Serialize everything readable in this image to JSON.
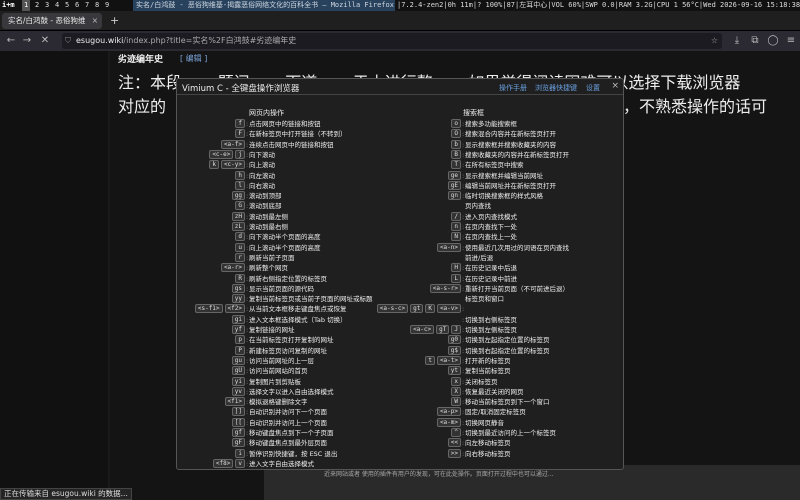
{
  "topbar": {
    "logo": "i+m",
    "workspaces": [
      "1",
      "2",
      "3",
      "4",
      "5",
      "6",
      "7",
      "8",
      "9"
    ],
    "active_workspace": "1",
    "window_title": "实名/白鸿鼓 - 恶俗狗维基-揭露恶俗网络文化的百科全书 — Mozilla Firefox",
    "status": "|7.2.4-zen2|0h 11m|? 100%|87|左耳中心|VOL 60%|SWP 0.0|RAM 3.2G|CPU 1 56°C|Wed 2026-09-16 15:18:38"
  },
  "tab": {
    "title": "实名/白鸿鼓 - 恶俗狗维",
    "close": "×"
  },
  "newtab": "+",
  "url": {
    "host": "esugou.wiki",
    "path": "/index.php?title=实名%2F白鸿鼓#劣迹编年史"
  },
  "page": {
    "section_title": "劣迹编年史",
    "edit_link": "[ 编辑 ]",
    "line1": "注：本段 · · · 题问 · · · 下道 · · · 于本进行整 · · · 如果觉得阅读困难可以选择下载浏览器",
    "line2": "对应的",
    "line3": "，不熟悉操作的话可",
    "status_loading": "正在传输来自 esugou.wiki 的数据...",
    "bottom_text": "近来网站或者 使用的插件有用户的发现，可在此处操作。页面打开过程中也可以通过..."
  },
  "vimium": {
    "title": "Vimium C - 全键盘操作浏览器",
    "links": [
      "操作手册",
      "浏览器快捷键",
      "设置"
    ],
    "close": "×",
    "left_header": "网页内操作",
    "right_header": "搜索框",
    "left_rows": [
      {
        "keys": [
          "f"
        ],
        "desc": "点击网页中的链接和按钮"
      },
      {
        "keys": [
          "F"
        ],
        "desc": "在新标签页中打开链接（不转到）"
      },
      {
        "keys": [
          "<a-f>"
        ],
        "desc": "连续点击网页中的链接和按钮"
      },
      {
        "keys": [
          "<c-e>",
          "j"
        ],
        "desc": "向下滚动"
      },
      {
        "keys": [
          "k",
          "<c-y>"
        ],
        "desc": "向上滚动"
      },
      {
        "keys": [
          "h"
        ],
        "desc": "向左滚动"
      },
      {
        "keys": [
          "l"
        ],
        "desc": "向右滚动"
      },
      {
        "keys": [
          "gg"
        ],
        "desc": "滚动到顶部"
      },
      {
        "keys": [
          "G"
        ],
        "desc": "滚动到底部"
      },
      {
        "keys": [
          "zH"
        ],
        "desc": "滚动到最左侧"
      },
      {
        "keys": [
          "zL"
        ],
        "desc": "滚动到最右侧"
      },
      {
        "keys": [
          "d"
        ],
        "desc": "向下滚动半个页面的高度"
      },
      {
        "keys": [
          "u"
        ],
        "desc": "向上滚动半个页面的高度"
      },
      {
        "keys": [
          "r"
        ],
        "desc": "刷新当前子页面"
      },
      {
        "keys": [
          "<a-r>"
        ],
        "desc": "刷新整个网页"
      },
      {
        "keys": [
          "R"
        ],
        "desc": "刷新右侧指定位置的标签页"
      },
      {
        "keys": [
          "gs"
        ],
        "desc": "显示当前页面的源代码"
      },
      {
        "keys": [
          "yy"
        ],
        "desc": "复制当前标签页或当前子页面的网址或标题"
      },
      {
        "keys": [
          "<s-f1>",
          "<f2>"
        ],
        "desc": "从当前文本框移走键盘焦点或恢复"
      },
      {
        "keys": [
          "gi"
        ],
        "desc": "进入文本框选择模式（Tab 切换）"
      },
      {
        "keys": [
          "yf"
        ],
        "desc": "复制链接的网址"
      },
      {
        "keys": [
          "p"
        ],
        "desc": "在当前标签页打开复制的网址"
      },
      {
        "keys": [
          "P"
        ],
        "desc": "新建标签页访问复制的网址"
      },
      {
        "keys": [
          "gu"
        ],
        "desc": "访问当前网址的上一层"
      },
      {
        "keys": [
          "gU"
        ],
        "desc": "访问当前网站的首页"
      },
      {
        "keys": [
          "yi"
        ],
        "desc": "复制图片到剪贴板"
      },
      {
        "keys": [
          "yv"
        ],
        "desc": "选择文字以进入自由选择模式"
      },
      {
        "keys": [
          "<f1>"
        ],
        "desc": "模拟退格键删除文字"
      },
      {
        "keys": [
          "]]"
        ],
        "desc": "自动识别并访问下一个页面"
      },
      {
        "keys": [
          "[["
        ],
        "desc": "自动识别并访问上一个页面"
      },
      {
        "keys": [
          "gf"
        ],
        "desc": "移动键盘焦点到下一个子页面"
      },
      {
        "keys": [
          "gF"
        ],
        "desc": "移动键盘焦点到最外层页面"
      },
      {
        "keys": [
          "i"
        ],
        "desc": "暂停识别快捷键，按 ESC 退出"
      },
      {
        "keys": [
          "<f8>",
          "v"
        ],
        "desc": "进入文字自由选择模式"
      }
    ],
    "right_rows": [
      {
        "keys": [
          "o"
        ],
        "desc": "搜索多功能搜索框",
        "type": "row"
      },
      {
        "keys": [
          "O"
        ],
        "desc": "搜索混合内容并在新标签页打开",
        "type": "row"
      },
      {
        "keys": [
          "b"
        ],
        "desc": "显示搜索框并搜索收藏夹的内容",
        "type": "row"
      },
      {
        "keys": [
          "B"
        ],
        "desc": "搜索收藏夹的内容并在新标签页打开",
        "type": "row"
      },
      {
        "keys": [
          "T"
        ],
        "desc": "在所有标签页中搜索",
        "type": "row"
      },
      {
        "keys": [
          "ge"
        ],
        "desc": "显示搜索框并编辑当前网址",
        "type": "row"
      },
      {
        "keys": [
          "gE"
        ],
        "desc": "编辑当前网址并在新标签页打开",
        "type": "row"
      },
      {
        "keys": [
          "gn"
        ],
        "desc": "临时切换搜索框的样式风格",
        "type": "row"
      },
      {
        "keys": [],
        "desc": "页内查找",
        "type": "head"
      },
      {
        "keys": [
          "/"
        ],
        "desc": "进入页内查找模式",
        "type": "row"
      },
      {
        "keys": [
          "n"
        ],
        "desc": "在页内查找下一处",
        "type": "row"
      },
      {
        "keys": [
          "N"
        ],
        "desc": "在页内查找上一处",
        "type": "row"
      },
      {
        "keys": [
          "<a-n>"
        ],
        "desc": "使用最近几次用过的词语在页内查找",
        "type": "row"
      },
      {
        "keys": [],
        "desc": "前进/后退",
        "type": "head"
      },
      {
        "keys": [
          "H"
        ],
        "desc": "在历史记录中后退",
        "type": "row"
      },
      {
        "keys": [
          "L"
        ],
        "desc": "在历史记录中前进",
        "type": "row"
      },
      {
        "keys": [
          "<a-s-r>"
        ],
        "desc": "重新打开当前页面（不可前进后退）",
        "type": "row"
      },
      {
        "keys": [],
        "desc": "标签页和窗口",
        "type": "head"
      },
      {
        "keys": [
          "<a-s-c>",
          "gt",
          "K",
          "<a-v>"
        ],
        "desc": "",
        "type": "row"
      },
      {
        "keys": [],
        "desc": "切换到右侧标签页",
        "type": "row"
      },
      {
        "keys": [
          "<a-c>",
          "gT",
          "J"
        ],
        "desc": "切换到左侧标签页",
        "type": "row"
      },
      {
        "keys": [
          "g0"
        ],
        "desc": "切换到左起指定位置的标签页",
        "type": "row"
      },
      {
        "keys": [
          "g$"
        ],
        "desc": "切换到右起指定位置的标签页",
        "type": "row"
      },
      {
        "keys": [
          "t",
          "<a-t>"
        ],
        "desc": "打开新的标签页",
        "type": "row"
      },
      {
        "keys": [
          "yt"
        ],
        "desc": "复制当前标签页",
        "type": "row"
      },
      {
        "keys": [
          "x"
        ],
        "desc": "关闭标签页",
        "type": "row"
      },
      {
        "keys": [
          "X"
        ],
        "desc": "恢复最近关闭的网页",
        "type": "row"
      },
      {
        "keys": [
          "W"
        ],
        "desc": "移动当前标签页到下一个窗口",
        "type": "row"
      },
      {
        "keys": [
          "<a-p>"
        ],
        "desc": "固定/取消固定标签页",
        "type": "row"
      },
      {
        "keys": [
          "<a-m>"
        ],
        "desc": "切换网页静音",
        "type": "row"
      },
      {
        "keys": [
          "^"
        ],
        "desc": "切换到最近访问的上一个标签页",
        "type": "row"
      },
      {
        "keys": [
          "<<"
        ],
        "desc": "向左移动标签页",
        "type": "row"
      },
      {
        "keys": [
          ">>"
        ],
        "desc": "向右移动标签页",
        "type": "row"
      }
    ]
  }
}
